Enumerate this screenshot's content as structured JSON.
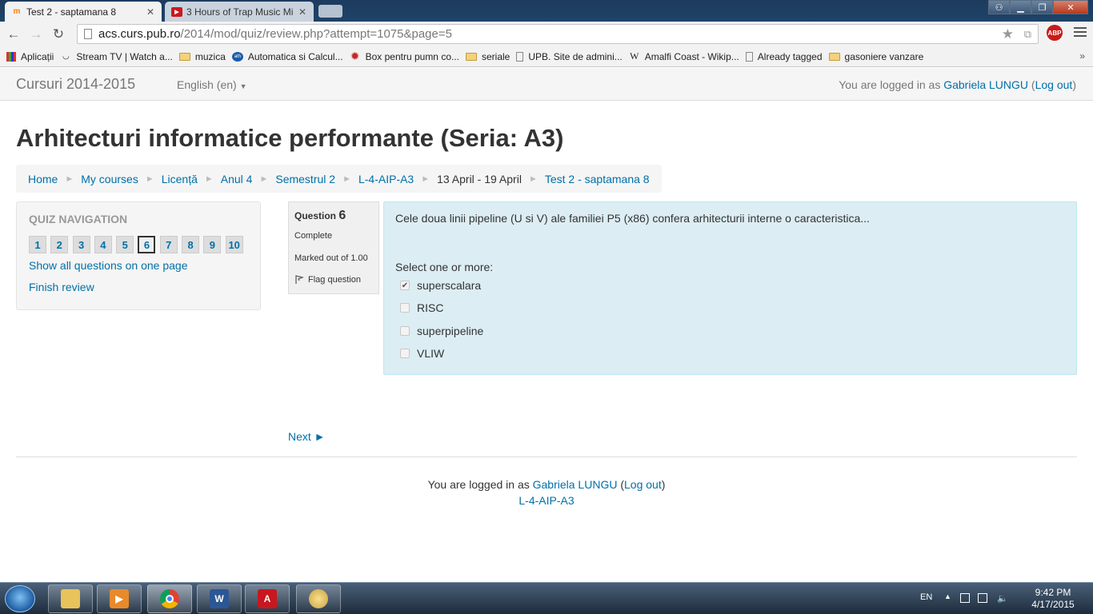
{
  "browser": {
    "tabs": [
      {
        "title": "Test 2 - saptamana 8",
        "active": true
      },
      {
        "title": "3 Hours of Trap Music Mi",
        "active": false
      }
    ],
    "url_host": "acs.curs.pub.ro",
    "url_path": "/2014/mod/quiz/review.php?attempt=1075&page=5",
    "adblock_label": "ABP",
    "bookmarks": [
      {
        "label": "Aplicații",
        "icon": "apps-grid-icon"
      },
      {
        "label": "Stream TV | Watch a...",
        "icon": "stream-icon"
      },
      {
        "label": "muzica",
        "icon": "folder-icon"
      },
      {
        "label": "Automatica si Calcul...",
        "icon": "site-icon"
      },
      {
        "label": "Box pentru pumn co...",
        "icon": "gear-red-icon"
      },
      {
        "label": "seriale",
        "icon": "folder-icon"
      },
      {
        "label": "UPB. Site de admini...",
        "icon": "page-icon"
      },
      {
        "label": "Amalfi Coast - Wikip...",
        "icon": "wikipedia-icon"
      },
      {
        "label": "Already tagged",
        "icon": "page-icon"
      },
      {
        "label": "gasoniere vanzare",
        "icon": "folder-icon"
      }
    ],
    "bookmarks_more": "»"
  },
  "navbar": {
    "brand": "Cursuri 2014-2015",
    "language": "English (en)",
    "logged_in_prefix": "You are logged in as ",
    "user_name": "Gabriela LUNGU",
    "logout": "Log out"
  },
  "page": {
    "course_title": "Arhitecturi informatice performante (Seria: A3)",
    "breadcrumb": [
      {
        "label": "Home",
        "link": true
      },
      {
        "label": "My courses",
        "link": true
      },
      {
        "label": "Licență",
        "link": true
      },
      {
        "label": "Anul 4",
        "link": true
      },
      {
        "label": "Semestrul 2",
        "link": true
      },
      {
        "label": "L-4-AIP-A3",
        "link": true
      },
      {
        "label": "13 April - 19 April",
        "link": false
      },
      {
        "label": "Test 2 - saptamana 8",
        "link": true
      }
    ]
  },
  "quiz_nav": {
    "title": "QUIZ NAVIGATION",
    "questions": [
      "1",
      "2",
      "3",
      "4",
      "5",
      "6",
      "7",
      "8",
      "9",
      "10"
    ],
    "current": "6",
    "show_all": "Show all questions on one page",
    "finish": "Finish review"
  },
  "question": {
    "label": "Question",
    "number": "6",
    "state": "Complete",
    "grade": "Marked out of 1.00",
    "flag": "Flag question",
    "text": "Cele doua linii pipeline (U si V) ale familiei P5 (x86) confera arhitecturii interne o caracteristica...",
    "prompt": "Select one or more:",
    "answers": [
      {
        "label": "superscalara",
        "checked": true
      },
      {
        "label": "RISC",
        "checked": false
      },
      {
        "label": "superpipeline",
        "checked": false
      },
      {
        "label": "VLIW",
        "checked": false
      }
    ]
  },
  "next_link": "Next ►",
  "footer": {
    "logged_in_prefix": "You are logged in as ",
    "user_name": "Gabriela LUNGU",
    "logout": "Log out",
    "course_short": "L-4-AIP-A3"
  },
  "taskbar": {
    "apps": [
      "file-explorer-icon",
      "media-player-icon",
      "chrome-icon",
      "word-icon",
      "acrobat-icon",
      "paint-icon"
    ],
    "language": "EN",
    "time": "9:42 PM",
    "date": "4/17/2015"
  }
}
